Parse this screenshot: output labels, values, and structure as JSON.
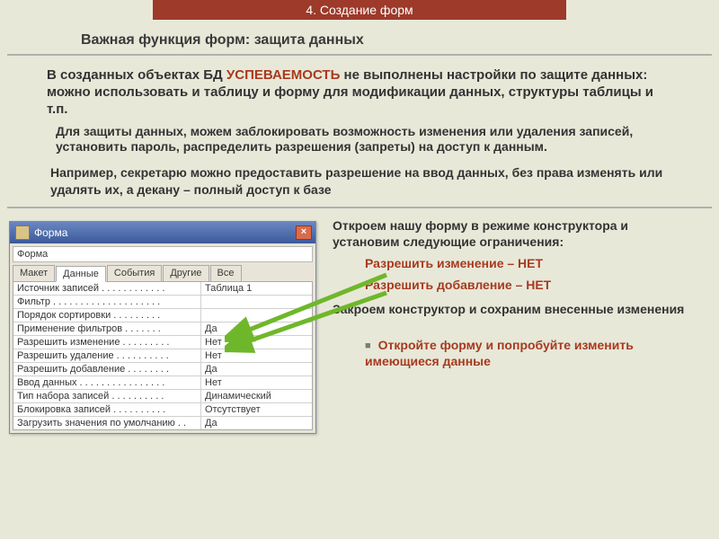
{
  "header": "4. Создание форм",
  "title": "Важная функция форм: защита данных",
  "para1_a": "В созданных объектах БД ",
  "para1_red": "УСПЕВАЕМОСТЬ",
  "para1_b": " не выполнены настройки по защите данных: можно использовать и таблицу и форму для модификации данных, структуры таблицы и т.п.",
  "sub1": "Для защиты данных, можем заблокировать возможность изменения или удаления записей, установить пароль, распределить разрешения (запреты) на доступ к данным.",
  "example": "Например, секретарю можно предоставить разрешение на ввод данных, без права изменять или удалять их, а декану – полный доступ к базе",
  "right": {
    "open": "Откроем нашу форму в режиме конструктора и установим следующие ограничения:",
    "r1": "Разрешить изменение – НЕТ",
    "r2": "Разрешить добавление – НЕТ",
    "close": "Закроем конструктор и сохраним внесенные изменения",
    "action": "Откройте форму и попробуйте изменить имеющиеся данные"
  },
  "dialog": {
    "title": "Форма",
    "close_x": "×",
    "combo": "Форма",
    "tabs": [
      "Макет",
      "Данные",
      "События",
      "Другие",
      "Все"
    ],
    "active_tab": 1,
    "rows": [
      {
        "label": "Источник записей . . . . . . . . . . . .",
        "value": "Таблица 1"
      },
      {
        "label": "Фильтр . . . . . . . . . . . . . . . . . . . .",
        "value": ""
      },
      {
        "label": "Порядок сортировки . . . . . . . . .",
        "value": ""
      },
      {
        "label": "Применение фильтров . . . . . . .",
        "value": "Да"
      },
      {
        "label": "Разрешить изменение . . . . . . . . .",
        "value": "Нет"
      },
      {
        "label": "Разрешить удаление . . . . . . . . . .",
        "value": "Нет"
      },
      {
        "label": "Разрешить добавление . . . . . . . .",
        "value": "Да"
      },
      {
        "label": "Ввод данных . . . . . . . . . . . . . . . .",
        "value": "Нет"
      },
      {
        "label": "Тип набора записей . . . . . . . . . .",
        "value": "Динамический"
      },
      {
        "label": "Блокировка записей . . . . . . . . . .",
        "value": "Отсутствует"
      },
      {
        "label": "Загрузить значения по умолчанию . .",
        "value": "Да"
      }
    ]
  }
}
